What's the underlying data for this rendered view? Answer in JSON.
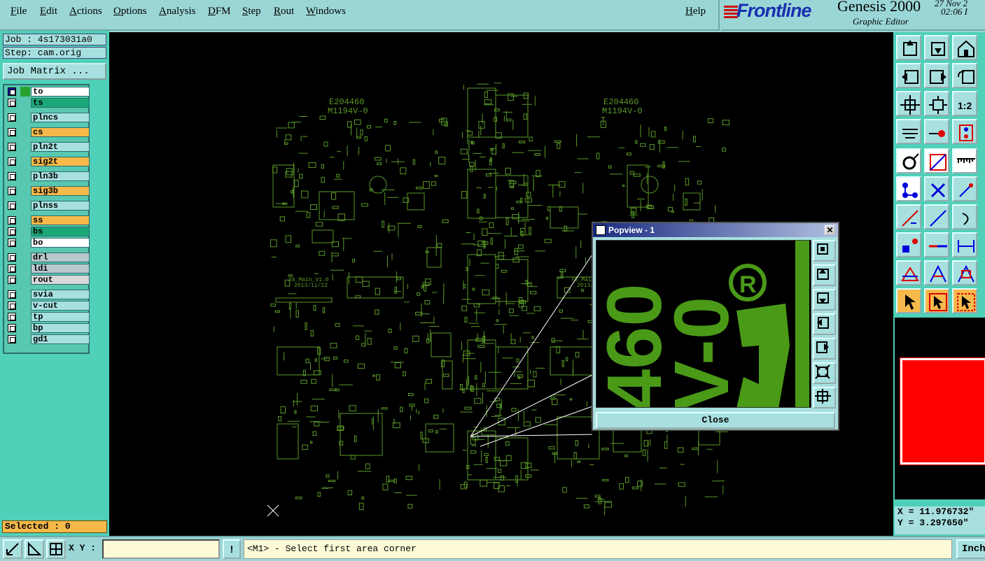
{
  "menu": {
    "items": [
      "File",
      "Edit",
      "Actions",
      "Options",
      "Analysis",
      "DFM",
      "Step",
      "Rout",
      "Windows"
    ],
    "help": "Help"
  },
  "branding": {
    "logo": "Frontline",
    "product": "Genesis 2000",
    "subtitle": "Graphic Editor",
    "date": "27 Nov 2",
    "time": "02:06 I"
  },
  "job": {
    "job_label": "Job : 4s173031a0",
    "step_label": "Step: cam.orig",
    "matrix_button": "Job Matrix ..."
  },
  "layers": [
    {
      "name": "to",
      "color": "#ffffff",
      "active": true
    },
    {
      "name": "ts",
      "color": "#1aa878"
    },
    {
      "name": "plncs",
      "color": "#a8e0e0"
    },
    {
      "name": "cs",
      "color": "#f7b94a"
    },
    {
      "name": "pln2t",
      "color": "#a8e0e0"
    },
    {
      "name": "sig2t",
      "color": "#f7b94a"
    },
    {
      "name": "pln3b",
      "color": "#a8e0e0"
    },
    {
      "name": "sig3b",
      "color": "#f7b94a"
    },
    {
      "name": "plnss",
      "color": "#a8e0e0"
    },
    {
      "name": "ss",
      "color": "#f7b94a"
    },
    {
      "name": "bs",
      "color": "#1aa878"
    },
    {
      "name": "bo",
      "color": "#ffffff"
    },
    {
      "name": "drl",
      "color": "#b8c8cc"
    },
    {
      "name": "ldi",
      "color": "#b8c8cc"
    },
    {
      "name": "rout",
      "color": "#d8d8d8"
    },
    {
      "name": "svia",
      "color": "#a8e0e0"
    },
    {
      "name": "v-cut",
      "color": "#a8e0e0"
    },
    {
      "name": "tp",
      "color": "#a8e0e0"
    },
    {
      "name": "bp",
      "color": "#a8e0e0"
    },
    {
      "name": "gd1",
      "color": "#a8e0e0"
    }
  ],
  "selected": "Selected : 0",
  "board_labels": {
    "ul_mark_left": "E204460",
    "ul_rating_left": "M1194V-0",
    "ul_mark_right": "E204460",
    "ul_rating_right": "M1194V-0",
    "version_left": "X6_Main_V1.0",
    "date_left": "2013/11/22",
    "version_right": "X6_Main_V1.0",
    "date_right": "2013/11/22"
  },
  "popview": {
    "title": "Popview - 1",
    "close_x": "✕",
    "close_button": "Close",
    "zoom_text_1": "460",
    "zoom_text_2": "V-0",
    "registered": "R"
  },
  "coords": {
    "x": "X = 11.976732\"",
    "y": "Y = 3.297650\""
  },
  "bottom": {
    "xy_label": "X Y :",
    "xy_value": "",
    "bang": "!",
    "prompt": "<M1> - Select first area corner",
    "units": "Inch"
  },
  "colors": {
    "board_green": "#5a9a28",
    "popview_green": "#4a9a18",
    "panel_teal": "#4fd0b8",
    "canvas_bg": "#000000",
    "profile_red": "#ff0000"
  }
}
